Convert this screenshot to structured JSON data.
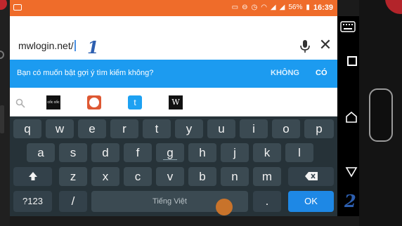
{
  "status_bar": {
    "battery_percent": "56%",
    "time": "16:39",
    "color": "#ef6c2a"
  },
  "url_bar": {
    "url": "mwlogin.net/",
    "annotation": "1"
  },
  "suggestion_banner": {
    "message": "Bạn có muốn bật gợi ý tìm kiếm không?",
    "no_label": "KHÔNG",
    "yes_label": "CÓ",
    "color": "#1c9bf0"
  },
  "shortcuts": {
    "coc_label": "cốc cốc",
    "twitter_glyph": "t",
    "wikipedia_glyph": "W"
  },
  "keyboard": {
    "row1": [
      "q",
      "w",
      "e",
      "r",
      "t",
      "y",
      "u",
      "i",
      "o",
      "p"
    ],
    "row2": [
      "a",
      "s",
      "d",
      "f",
      "g",
      "h",
      "j",
      "k",
      "l"
    ],
    "row3": [
      "z",
      "x",
      "c",
      "v",
      "b",
      "n",
      "m"
    ],
    "symbols_label": "?123",
    "slash_label": "/",
    "space_label": "Tiếng Việt",
    "period_label": ".",
    "ok_label": "OK"
  },
  "navbar": {
    "annotation": "2"
  }
}
